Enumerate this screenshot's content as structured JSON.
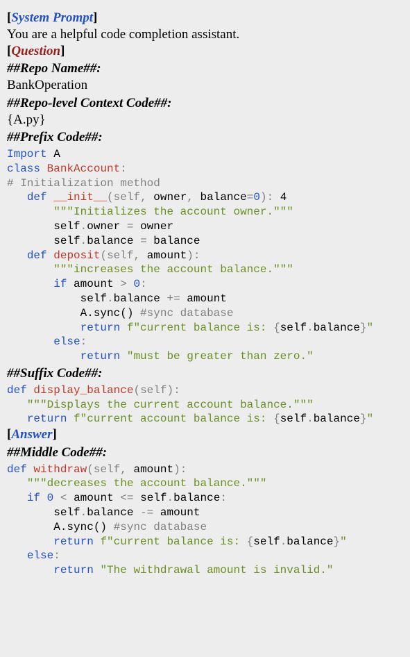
{
  "system_prompt": {
    "label": "System Prompt",
    "text": "You are a helpful code completion assistant."
  },
  "question": {
    "label": "Question",
    "repo_name_header": "##Repo Name##:",
    "repo_name": "BankOperation",
    "repo_context_header": "##Repo-level Context Code##:",
    "repo_context_value": "{A.py}",
    "prefix_header": "##Prefix Code##:",
    "prefix_code": {
      "l1": {
        "import": "Import",
        "mod": "A"
      },
      "l2": {
        "kw": "class",
        "name": "BankAccount",
        "colon": ":"
      },
      "l3": {
        "comment": "# Initialization method"
      },
      "l4": {
        "def": "def",
        "name": "__init__",
        "lp": "(",
        "p1": "self",
        "c1": ",",
        "p2": "owner",
        "c2": ",",
        "p3": "balance",
        "eq": "=",
        "zero": "0",
        "rp": ")",
        "colon": ":",
        "trail": " 4"
      },
      "l5": {
        "doc": "\"\"\"Initializes the account owner.\"\"\""
      },
      "l6": {
        "s": "self",
        "d": ".",
        "attr": "owner",
        "eq": "=",
        "rhs": "owner"
      },
      "l7": {
        "s": "self",
        "d": ".",
        "attr": "balance",
        "eq": "=",
        "rhs": "balance"
      },
      "l8": {
        "def": "def",
        "name": "deposit",
        "lp": "(",
        "p1": "self",
        "c1": ",",
        "p2": "amount",
        "rp": ")",
        "colon": ":"
      },
      "l9": {
        "doc": "\"\"\"increases the account balance.\"\"\""
      },
      "l10": {
        "if": "if",
        "var": "amount",
        "gt": ">",
        "zero": "0",
        "colon": ":"
      },
      "l11": {
        "s": "self",
        "d": ".",
        "attr": "balance",
        "op": "+=",
        "rhs": "amount"
      },
      "l12": {
        "call": "A.sync() ",
        "comment": "#sync database"
      },
      "l13": {
        "ret": "return",
        "f1": "f\"current balance is: ",
        "lb": "{",
        "s": "self",
        "d": ".",
        "attr": "balance",
        "rb": "}",
        "f2": "\""
      },
      "l14": {
        "else": "else",
        "colon": ":"
      },
      "l15": {
        "ret": "return",
        "str": "\"must be greater than zero.\""
      }
    },
    "suffix_header": "##Suffix Code##:",
    "suffix_code": {
      "l1": {
        "def": "def",
        "name": "display_balance",
        "lp": "(",
        "p1": "self",
        "rp": ")",
        "colon": ":"
      },
      "l2": {
        "doc": "\"\"\"Displays the current account balance.\"\"\""
      },
      "l3": {
        "ret": "return",
        "f1": "f\"current account balance is: ",
        "lb": "{",
        "s": "self",
        "d": ".",
        "attr": "balance",
        "rb": "}",
        "f2": "\""
      }
    }
  },
  "answer": {
    "label": "Answer",
    "middle_header": "##Middle Code##:",
    "middle_code": {
      "l1": {
        "def": "def",
        "name": "withdraw",
        "lp": "(",
        "p1": "self",
        "c1": ",",
        "p2": "amount",
        "rp": ")",
        "colon": ":"
      },
      "l2": {
        "doc": "\"\"\"decreases the account balance.\"\"\""
      },
      "l3": {
        "if": "if",
        "zero": "0",
        "lt": "<",
        "var": "amount",
        "le": "<=",
        "s": "self",
        "d": ".",
        "attr": "balance",
        "colon": ":"
      },
      "l4": {
        "s": "self",
        "d": ".",
        "attr": "balance",
        "op": "-=",
        "rhs": "amount"
      },
      "l5": {
        "call": "A.sync() ",
        "comment": "#sync database"
      },
      "l6": {
        "ret": "return",
        "f1": "f\"current balance is: ",
        "lb": "{",
        "s": "self",
        "d": ".",
        "attr": "balance",
        "rb": "}",
        "f2": "\""
      },
      "l7": {
        "else": "else",
        "colon": ":"
      },
      "l8": {
        "ret": "return",
        "str": "\"The withdrawal amount is invalid.\""
      }
    }
  }
}
